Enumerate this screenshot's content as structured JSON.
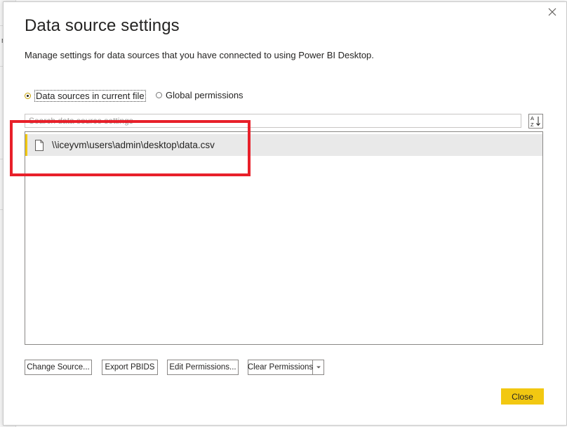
{
  "background": {
    "edge_char": "r"
  },
  "dialog": {
    "title": "Data source settings",
    "subtitle": "Manage settings for data sources that you have connected to using Power BI Desktop.",
    "close_icon": "close-icon"
  },
  "scope": {
    "options": [
      {
        "label": "Data sources in current file",
        "checked": true
      },
      {
        "label": "Global permissions",
        "checked": false
      }
    ]
  },
  "search": {
    "placeholder": "Search data source settings",
    "value": ""
  },
  "sort_icon": "sort-az-icon",
  "sources": [
    {
      "path": "\\\\iceyvm\\users\\admin\\desktop\\data.csv",
      "icon": "file-icon",
      "selected": true
    }
  ],
  "buttons": {
    "change_source": "Change Source...",
    "export_pbids": "Export PBIDS",
    "edit_permissions": "Edit Permissions...",
    "clear_permissions": "Clear Permissions",
    "close": "Close"
  },
  "colors": {
    "accent": "#f2c811",
    "highlight": "#e8202a",
    "selected_row": "#e9e9e9"
  }
}
